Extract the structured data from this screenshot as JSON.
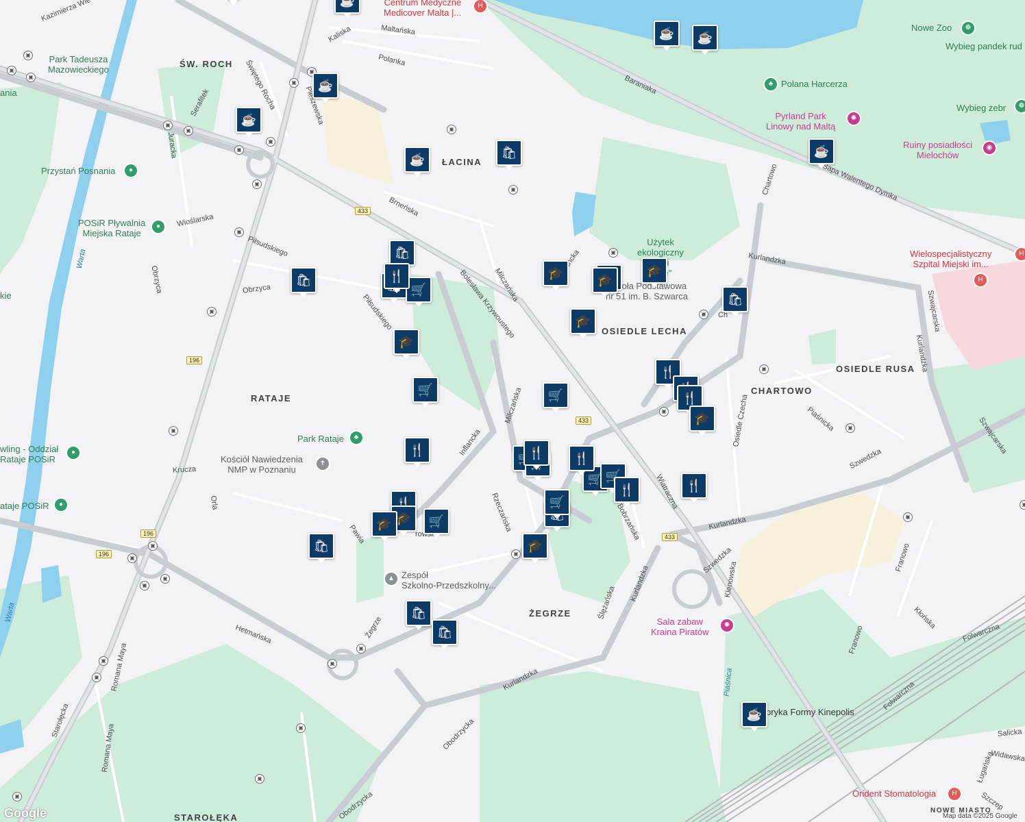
{
  "map": {
    "attribution": "Map data ©2025 Google",
    "logo": "Google",
    "colors": {
      "water": "#8fd0ee",
      "park": "#cdecd9",
      "industrial": "#f7f0db",
      "hospital": "#f7d8dc",
      "road_major": "#c9ccd2",
      "road_minor": "#ffffff",
      "rail": "#b7b9bf",
      "pin": "#0d3b66"
    }
  },
  "labels": {
    "district_roch": "ŚW. ROCH",
    "district_lacina": "ŁACINA",
    "district_rataje": "RATAJE",
    "district_lecha": "OSIEDLE LECHA",
    "district_chartowo": "CHARTOWO",
    "district_rusa": "OSIEDLE RUSA",
    "district_zegrze": "ŻEGRZE",
    "district_starolęka": "STAROŁĘKA",
    "district_nowe_miasto": "NOWE MIASTO",
    "street_kazimierza": "Kazimierza Wie",
    "street_kaliska": "Kaliska",
    "street_maltanska": "Maltańska",
    "street_polanka": "Polanka",
    "street_baraniaka": "Baraniaka",
    "street_swroch": "Świętego Rocha",
    "street_serafitek": "Serafitek",
    "street_juracka": "Juracka",
    "street_pleszewska": "Pleszewska",
    "street_brnenska": "Brneńska",
    "street_wioslarska": "Wioślarska",
    "street_pilsudskiego1": "Piłsudskiego",
    "street_pilsudskiego2": "Piłsudskiego",
    "street_obrzyca1": "Obrzyca",
    "street_obrzyca2": "Obrzyca",
    "street_boleslawa": "Bolesława Krzywoustego",
    "street_milczanska1": "Milczańska",
    "street_milczanska2": "Milczańska",
    "street_inflancka1": "Inflancka",
    "street_inflancka2": "ancka",
    "street_krucza": "Krucza",
    "street_orla": "Orla",
    "street_pawia": "Pawia",
    "street_rzeczanska": "Rzeczańska",
    "street_bobrzanska": "Bobrzańska",
    "street_wiatraczna": "Wiatraczna",
    "street_kurlandzka1": "Kurlandzka",
    "street_kurlandzka2": "Kurlandzka",
    "street_kurlandzka3": "Kurlandzka",
    "street_kurlandzka4": "Kurlandzka",
    "street_kurlandzka5": "Kurlandzka",
    "street_szwedzka1": "Szwedzka",
    "street_szwedzka2": "Szwedzka",
    "street_szwajcarska1": "Szwajcarska",
    "street_szwajcarska2": "Szwajcarska",
    "street_piasnicka": "Piaśnicka",
    "street_chartowo": "Chartowo",
    "street_osiedle_czecha": "Osiedle Czecha",
    "street_klenowska": "Klenowska",
    "street_franowo1": "Franowo",
    "street_franowo2": "Franowo",
    "street_klonska": "Kłońska",
    "street_folwarczna1": "Folwarczna",
    "street_folwarczna2": "Folwarczna",
    "street_salicka": "Salicka",
    "street_widawska": "Widawska",
    "street_luganska": "Ługańska",
    "street_szczep": "Szczep",
    "street_slezanska": "Ślężańska",
    "street_zegrze": "Żegrze",
    "street_hetmanska": "Hetmańska",
    "street_obodrzycka1": "Obodrzycka",
    "street_obodrzycka2": "Obodrzycka",
    "street_starolecka": "Starołęcka",
    "street_romana_maya1": "Romana Maya",
    "street_romana_maya2": "Romana Maya",
    "street_warta1": "Warta",
    "street_warta2": "Warta",
    "street_piasnica": "Piaśnica",
    "street_dymka": "Sapa Walentego Dymka",
    "street_ch": "Ch",
    "street_browska": "rowsk",
    "route_433a": "433",
    "route_433b": "433",
    "route_433c": "433",
    "route_196a": "196",
    "route_196b": "196",
    "route_196c": "196"
  },
  "pois": {
    "centrum": "Centrum Medyczne\nMedicover Malta |...",
    "nowe_zoo": "Nowe Zoo",
    "pandek": "Wybieg pandek rud",
    "polana": "Polana Harcerza",
    "pyrland": "Pyrland Park\nLinowy nad Maltą",
    "zebr": "Wybieg zebr",
    "ruiny": "Ruiny posiadłości\nMielochów",
    "park_tadeusza": "Park Tadeusza\nMazowieckiego",
    "przystan": "Przystań Posnania",
    "posir": "POSiR Pływalnia\nMiejska Rataje",
    "uzytek": "Użytek\nekologiczny\n\"...ki\nP...ie\"",
    "szkola51": "Szkoła Podstawowa\nnr 51 im. B. Szwarca",
    "wielospec": "Wielospecjalistyczny\nSzpital Miejski im...",
    "park_rataje": "Park Rataje",
    "kosciol": "Kościół Nawiedzenia\nNMP w Poznaniu",
    "bowling": "wling - Oddział\nRataje POSiR",
    "rataje_posir": "ataje POSiR",
    "zespol": "Zespół\nSzkolno-Przedszkolny...",
    "sala": "Sala zabaw\nKraina Piratów",
    "kinepolis": "bryka Formy Kinepolis",
    "orident": "Orident Stomatologia",
    "ania": "ania",
    "kie": "kie"
  }
}
